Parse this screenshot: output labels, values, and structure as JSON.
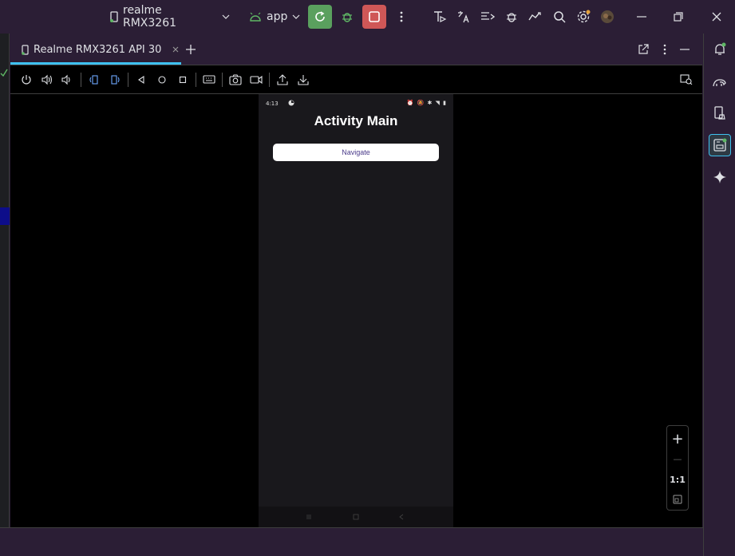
{
  "topbar": {
    "device_label": "realme RMX3261",
    "config_label": "app",
    "icons": [
      "phone-icon",
      "chevron-down-icon",
      "android-icon",
      "chevron-down-icon",
      "rerun-icon",
      "debug-icon",
      "stop-icon",
      "more-icon",
      "api-icon",
      "translate-icon",
      "format-icon",
      "bug-icon",
      "sync-icon",
      "search-icon",
      "settings-icon",
      "avatar",
      "minimize-icon",
      "restore-icon",
      "close-icon"
    ]
  },
  "running_devices": {
    "tab_label": "Realme RMX3261 API 30",
    "toolbar_icons": [
      "power-icon",
      "volume-up-icon",
      "volume-down-icon",
      "rotate-left-icon",
      "rotate-right-icon",
      "back-icon",
      "home-icon",
      "overview-icon",
      "keyboard-icon",
      "screenshot-icon",
      "screenrecord-icon",
      "upload-icon",
      "download-icon",
      "device-explorer-icon"
    ]
  },
  "phone": {
    "status_time": "4:13",
    "status_icons": "⏰ 🔕 ✱ ◥ ▮",
    "app_title": "Activity Main",
    "button_label": "Navigate"
  },
  "zoom": {
    "plus": "+",
    "minus": "—",
    "one_to_one": "1:1"
  },
  "colors": {
    "chrome": "#2b1e35",
    "accent": "#3ec1f0",
    "run": "#5aa05e",
    "stop": "#cf5757"
  }
}
